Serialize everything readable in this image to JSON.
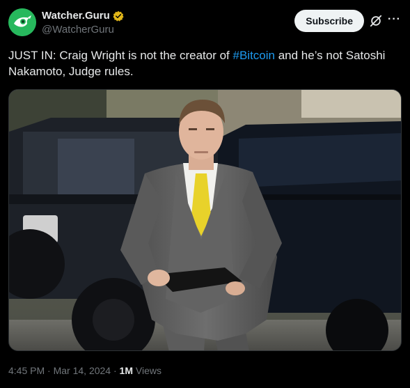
{
  "author": {
    "display_name": "Watcher.Guru",
    "handle": "@WatcherGuru",
    "verified": true,
    "avatar_icon": "watcher-guru-eye-logo",
    "verified_icon": "gold-verified-badge-icon"
  },
  "actions": {
    "subscribe_label": "Subscribe",
    "grok_icon": "grok-icon",
    "more_icon": "more-options-icon",
    "more_glyph": "···"
  },
  "tweet": {
    "text_before": "JUST IN: Craig Wright is not the creator of ",
    "hashtag": "#Bitcoin",
    "text_after": " and he’s not Satoshi Nakamoto, Judge rules."
  },
  "footer": {
    "time": "4:45 PM",
    "sep1": " · ",
    "date": "Mar 14, 2024",
    "sep2": " · ",
    "views_count": "1M",
    "views_label": " Views"
  },
  "colors": {
    "background": "#000000",
    "text": "#e7e9ea",
    "muted": "#71767b",
    "link": "#1d9bf0",
    "subscribe_bg": "#eff3f4",
    "avatar_green": "#27b85d",
    "verified_gold": "#e2b719"
  }
}
